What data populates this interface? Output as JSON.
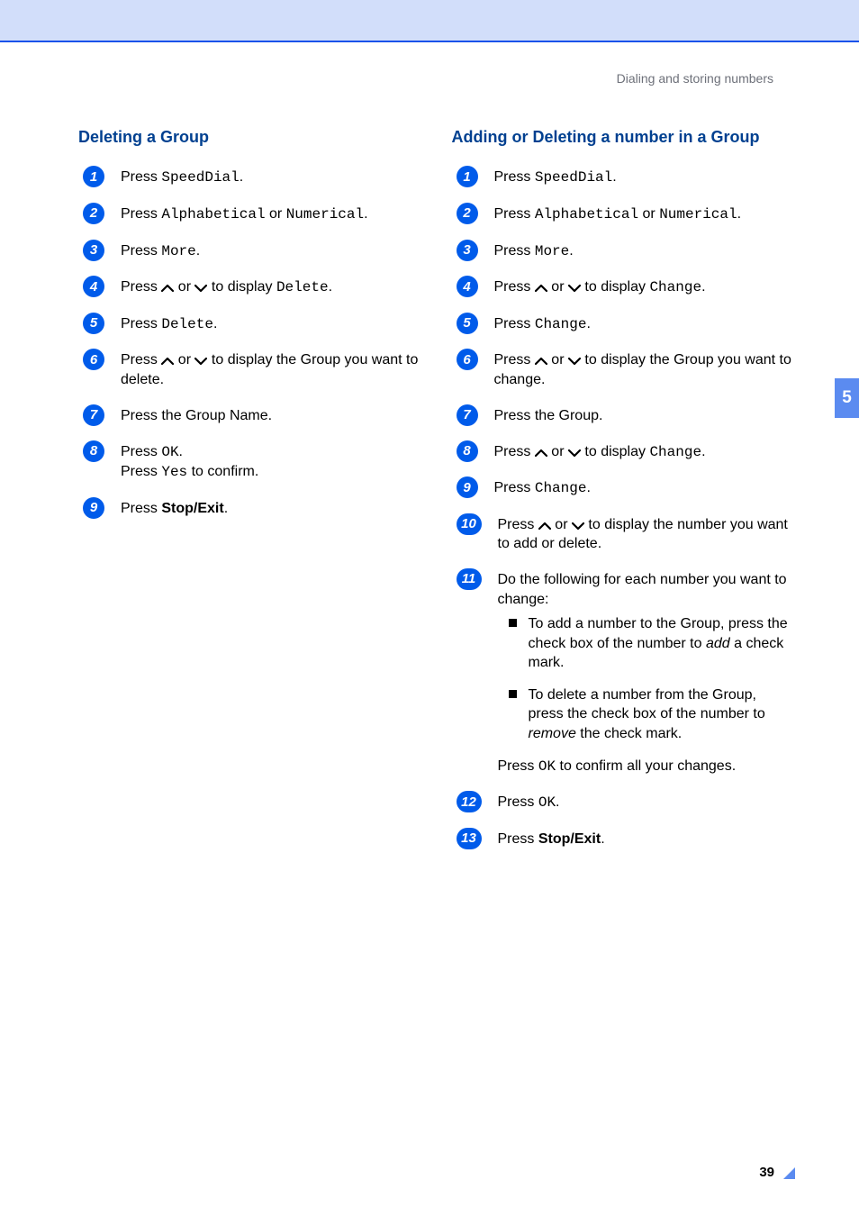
{
  "header": {
    "section_label": "Dialing and storing numbers"
  },
  "sidebar": {
    "chapter": "5"
  },
  "footer": {
    "page": "39"
  },
  "left": {
    "title": "Deleting a Group",
    "steps": [
      {
        "n": "1",
        "parts": [
          {
            "t": "Press ",
            "k": "n"
          },
          {
            "t": "SpeedDial",
            "k": "m"
          },
          {
            "t": ".",
            "k": "n"
          }
        ]
      },
      {
        "n": "2",
        "parts": [
          {
            "t": "Press ",
            "k": "n"
          },
          {
            "t": "Alphabetical",
            "k": "m"
          },
          {
            "t": " or ",
            "k": "n"
          },
          {
            "t": "Numerical",
            "k": "m"
          },
          {
            "t": ".",
            "k": "n"
          }
        ]
      },
      {
        "n": "3",
        "parts": [
          {
            "t": "Press ",
            "k": "n"
          },
          {
            "t": "More",
            "k": "m"
          },
          {
            "t": ".",
            "k": "n"
          }
        ]
      },
      {
        "n": "4",
        "parts": [
          {
            "t": "Press ",
            "k": "n"
          },
          {
            "t": "",
            "k": "up"
          },
          {
            "t": " or ",
            "k": "n"
          },
          {
            "t": "",
            "k": "down"
          },
          {
            "t": " to display ",
            "k": "n"
          },
          {
            "t": "Delete",
            "k": "m"
          },
          {
            "t": ".",
            "k": "n"
          }
        ]
      },
      {
        "n": "5",
        "parts": [
          {
            "t": "Press ",
            "k": "n"
          },
          {
            "t": "Delete",
            "k": "m"
          },
          {
            "t": ".",
            "k": "n"
          }
        ]
      },
      {
        "n": "6",
        "parts": [
          {
            "t": "Press ",
            "k": "n"
          },
          {
            "t": "",
            "k": "up"
          },
          {
            "t": " or ",
            "k": "n"
          },
          {
            "t": "",
            "k": "down"
          },
          {
            "t": " to display the Group you want to delete.",
            "k": "n"
          }
        ]
      },
      {
        "n": "7",
        "parts": [
          {
            "t": "Press the Group Name.",
            "k": "n"
          }
        ]
      },
      {
        "n": "8",
        "parts": [
          {
            "t": "Press ",
            "k": "n"
          },
          {
            "t": "OK",
            "k": "m"
          },
          {
            "t": ".",
            "k": "n"
          },
          {
            "t": "\n",
            "k": "br"
          },
          {
            "t": "Press ",
            "k": "n"
          },
          {
            "t": "Yes",
            "k": "m"
          },
          {
            "t": " to confirm.",
            "k": "n"
          }
        ]
      },
      {
        "n": "9",
        "parts": [
          {
            "t": "Press ",
            "k": "n"
          },
          {
            "t": "Stop/Exit",
            "k": "b"
          },
          {
            "t": ".",
            "k": "n"
          }
        ]
      }
    ]
  },
  "right": {
    "title": "Adding or Deleting a number in a Group",
    "steps": [
      {
        "n": "1",
        "parts": [
          {
            "t": "Press ",
            "k": "n"
          },
          {
            "t": "SpeedDial",
            "k": "m"
          },
          {
            "t": ".",
            "k": "n"
          }
        ]
      },
      {
        "n": "2",
        "parts": [
          {
            "t": "Press ",
            "k": "n"
          },
          {
            "t": "Alphabetical",
            "k": "m"
          },
          {
            "t": " or ",
            "k": "n"
          },
          {
            "t": "Numerical",
            "k": "m"
          },
          {
            "t": ".",
            "k": "n"
          }
        ]
      },
      {
        "n": "3",
        "parts": [
          {
            "t": "Press ",
            "k": "n"
          },
          {
            "t": "More",
            "k": "m"
          },
          {
            "t": ".",
            "k": "n"
          }
        ]
      },
      {
        "n": "4",
        "parts": [
          {
            "t": "Press ",
            "k": "n"
          },
          {
            "t": "",
            "k": "up"
          },
          {
            "t": " or ",
            "k": "n"
          },
          {
            "t": "",
            "k": "down"
          },
          {
            "t": " to display ",
            "k": "n"
          },
          {
            "t": "Change",
            "k": "m"
          },
          {
            "t": ".",
            "k": "n"
          }
        ]
      },
      {
        "n": "5",
        "parts": [
          {
            "t": "Press ",
            "k": "n"
          },
          {
            "t": "Change",
            "k": "m"
          },
          {
            "t": ".",
            "k": "n"
          }
        ]
      },
      {
        "n": "6",
        "parts": [
          {
            "t": "Press ",
            "k": "n"
          },
          {
            "t": "",
            "k": "up"
          },
          {
            "t": " or ",
            "k": "n"
          },
          {
            "t": "",
            "k": "down"
          },
          {
            "t": " to display the Group you want to change.",
            "k": "n"
          }
        ]
      },
      {
        "n": "7",
        "parts": [
          {
            "t": "Press the Group.",
            "k": "n"
          }
        ]
      },
      {
        "n": "8",
        "parts": [
          {
            "t": "Press ",
            "k": "n"
          },
          {
            "t": "",
            "k": "up"
          },
          {
            "t": " or ",
            "k": "n"
          },
          {
            "t": "",
            "k": "down"
          },
          {
            "t": " to display ",
            "k": "n"
          },
          {
            "t": "Change",
            "k": "m"
          },
          {
            "t": ".",
            "k": "n"
          }
        ]
      },
      {
        "n": "9",
        "parts": [
          {
            "t": "Press ",
            "k": "n"
          },
          {
            "t": "Change",
            "k": "m"
          },
          {
            "t": ".",
            "k": "n"
          }
        ]
      },
      {
        "n": "10",
        "parts": [
          {
            "t": "Press ",
            "k": "n"
          },
          {
            "t": "",
            "k": "up"
          },
          {
            "t": " or ",
            "k": "n"
          },
          {
            "t": "",
            "k": "down"
          },
          {
            "t": " to display the number you want to add or delete.",
            "k": "n"
          }
        ]
      },
      {
        "n": "11",
        "parts": [
          {
            "t": "Do the following for each number you want to change:",
            "k": "n"
          }
        ],
        "bullets": [
          [
            {
              "t": "To add a number to the Group, press the check box of the number to ",
              "k": "n"
            },
            {
              "t": "add",
              "k": "i"
            },
            {
              "t": " a check mark.",
              "k": "n"
            }
          ],
          [
            {
              "t": "To delete a number from the Group, press the check box of the number to ",
              "k": "n"
            },
            {
              "t": "remove",
              "k": "i"
            },
            {
              "t": " the check mark.",
              "k": "n"
            }
          ]
        ],
        "after": [
          {
            "t": "Press ",
            "k": "n"
          },
          {
            "t": "OK",
            "k": "m"
          },
          {
            "t": " to confirm all your changes.",
            "k": "n"
          }
        ]
      },
      {
        "n": "12",
        "parts": [
          {
            "t": "Press ",
            "k": "n"
          },
          {
            "t": "OK",
            "k": "m"
          },
          {
            "t": ".",
            "k": "n"
          }
        ]
      },
      {
        "n": "13",
        "parts": [
          {
            "t": "Press ",
            "k": "n"
          },
          {
            "t": "Stop/Exit",
            "k": "b"
          },
          {
            "t": ".",
            "k": "n"
          }
        ]
      }
    ]
  }
}
